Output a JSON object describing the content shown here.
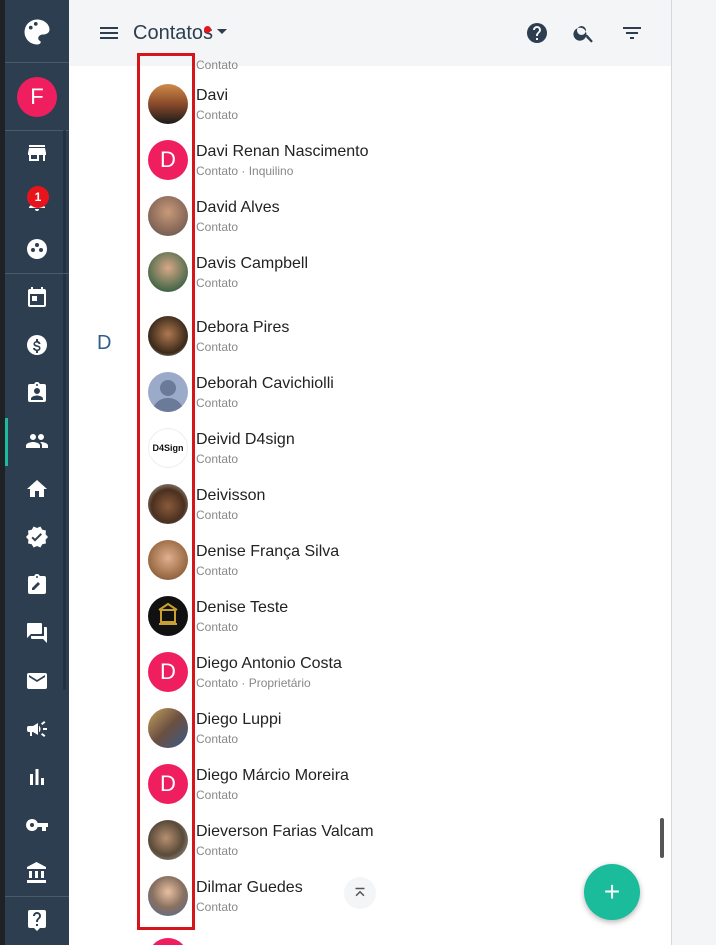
{
  "header": {
    "title": "Contatos",
    "icons": [
      "menu-icon",
      "help-icon",
      "search-icon",
      "filter-icon"
    ]
  },
  "sidebar": {
    "user_initial": "F",
    "notification_count": "1",
    "items": [
      "logo-icon",
      "store-icon",
      "bell-icon",
      "dashboard-icon",
      "calendar-icon",
      "money-icon",
      "badge-icon",
      "contacts-icon",
      "home-icon",
      "verified-icon",
      "clipboard-icon",
      "chat-icon",
      "mail-icon",
      "megaphone-icon",
      "chart-icon",
      "key-icon",
      "bank-icon",
      "help-icon"
    ]
  },
  "list": {
    "partial_top_sub": "Contato",
    "section_letter": "D",
    "contacts": [
      {
        "name": "Davi",
        "sub": "Contato",
        "avatar": "photo"
      },
      {
        "name": "Davi Renan Nascimento",
        "sub": "Contato · Inquilino",
        "avatar": "D"
      },
      {
        "name": "David Alves",
        "sub": "Contato",
        "avatar": "photo"
      },
      {
        "name": "Davis Campbell",
        "sub": "Contato",
        "avatar": "photo"
      },
      {
        "name": "Debora Pires",
        "sub": "Contato",
        "avatar": "photo"
      },
      {
        "name": "Deborah Cavichiolli",
        "sub": "Contato",
        "avatar": "default"
      },
      {
        "name": "Deivid D4sign",
        "sub": "Contato",
        "avatar": "D4Sign"
      },
      {
        "name": "Deivisson",
        "sub": "Contato",
        "avatar": "photo"
      },
      {
        "name": "Denise França Silva",
        "sub": "Contato",
        "avatar": "photo"
      },
      {
        "name": "Denise Teste",
        "sub": "Contato",
        "avatar": "photo"
      },
      {
        "name": "Diego Antonio Costa",
        "sub": "Contato · Proprietário",
        "avatar": "D"
      },
      {
        "name": "Diego Luppi",
        "sub": "Contato",
        "avatar": "photo"
      },
      {
        "name": "Diego Márcio Moreira",
        "sub": "Contato",
        "avatar": "D"
      },
      {
        "name": "Dieverson Farias Valcam",
        "sub": "Contato",
        "avatar": "photo"
      },
      {
        "name": "Dilmar Guedes",
        "sub": "Contato",
        "avatar": "photo"
      }
    ]
  },
  "fab": {
    "label": "+"
  },
  "colors": {
    "accent": "#1abc9c",
    "avatar_letter_bg": "#ef1f5f",
    "sidebar_bg": "#2c3e50",
    "highlight": "#d7141a"
  }
}
